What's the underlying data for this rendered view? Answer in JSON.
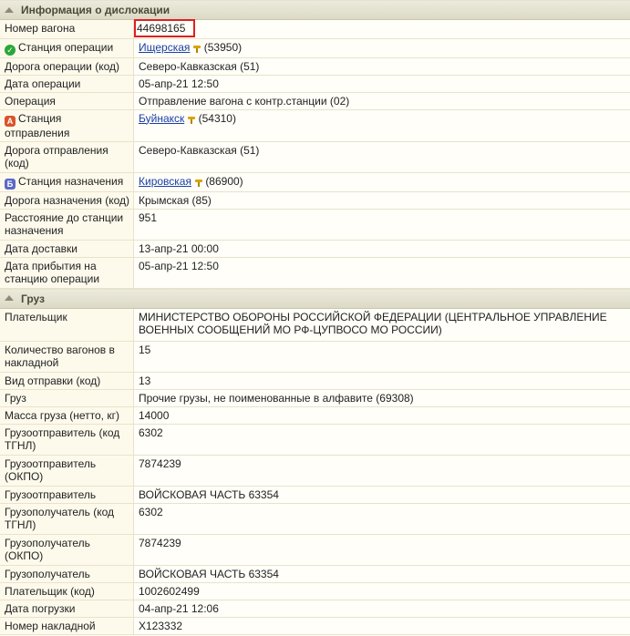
{
  "sections": {
    "dislocation": {
      "title": "Информация о дислокации"
    },
    "cargo": {
      "title": "Груз"
    }
  },
  "dislocation": {
    "wagon_number": {
      "label": "Номер вагона",
      "value": "44698165"
    },
    "op_station": {
      "label": "Станция операции",
      "name": "Ищерская",
      "code": "(53950)"
    },
    "op_road": {
      "label": "Дорога операции (код)",
      "value": "Северо-Кавказская (51)"
    },
    "op_date": {
      "label": "Дата операции",
      "value": "05-апр-21  12:50"
    },
    "operation": {
      "label": "Операция",
      "value": "Отправление вагона с контр.станции (02)"
    },
    "dep_station": {
      "label": "Станция отправления",
      "name": "Буйнакск",
      "code": "(54310)"
    },
    "dep_road": {
      "label": "Дорога отправления (код)",
      "value": "Северо-Кавказская (51)"
    },
    "dest_station": {
      "label": "Станция назначения",
      "name": "Кировская",
      "code": "(86900)"
    },
    "dest_road": {
      "label": "Дорога назначения (код)",
      "value": "Крымская (85)"
    },
    "distance": {
      "label": "Расстояние до станции назначения",
      "value": "951"
    },
    "delivery_date": {
      "label": "Дата доставки",
      "value": "13-апр-21  00:00"
    },
    "arrival_date": {
      "label": "Дата прибытия на станцию операции",
      "value": "05-апр-21  12:50"
    }
  },
  "cargo": {
    "payer": {
      "label": "Плательщик",
      "value": "МИНИСТЕРСТВО ОБОРОНЫ РОССИЙСКОЙ ФЕДЕРАЦИИ (ЦЕНТРАЛЬНОЕ УПРАВЛЕНИЕ ВОЕННЫХ СООБЩЕНИЙ МО РФ-ЦУПВОСО МО РОССИИ)"
    },
    "wagons_count": {
      "label": "Количество вагонов в накладной",
      "value": "15"
    },
    "shipment_type": {
      "label": "Вид отправки (код)",
      "value": "13"
    },
    "cargo_name": {
      "label": "Груз",
      "value": "Прочие грузы, не поименованные в алфавите (69308)"
    },
    "weight": {
      "label": "Масса груза (нетто, кг)",
      "value": "14000"
    },
    "sender_tgnl": {
      "label": "Грузоотправитель (код ТГНЛ)",
      "value": "6302"
    },
    "sender_okpo": {
      "label": "Грузоотправитель (ОКПО)",
      "value": "7874239"
    },
    "sender": {
      "label": "Грузоотправитель",
      "value": "ВОЙСКОВАЯ ЧАСТЬ 63354"
    },
    "receiver_tgnl": {
      "label": "Грузополучатель (код ТГНЛ)",
      "value": "6302"
    },
    "receiver_okpo": {
      "label": "Грузополучатель (ОКПО)",
      "value": "7874239"
    },
    "receiver": {
      "label": "Грузополучатель",
      "value": "ВОЙСКОВАЯ ЧАСТЬ 63354"
    },
    "payer_code": {
      "label": "Плательщик (код)",
      "value": "1002602499"
    },
    "loading_date": {
      "label": "Дата погрузки",
      "value": "04-апр-21  12:06"
    },
    "waybill": {
      "label": "Номер накладной",
      "value": "X123332"
    }
  },
  "icons": {
    "op_station": "check-circle-icon",
    "dep_station": "letter-a-icon",
    "dest_station": "letter-b-icon",
    "station_marker": "station-marker-icon"
  },
  "badge_letters": {
    "dep": "А",
    "dest": "Б"
  }
}
